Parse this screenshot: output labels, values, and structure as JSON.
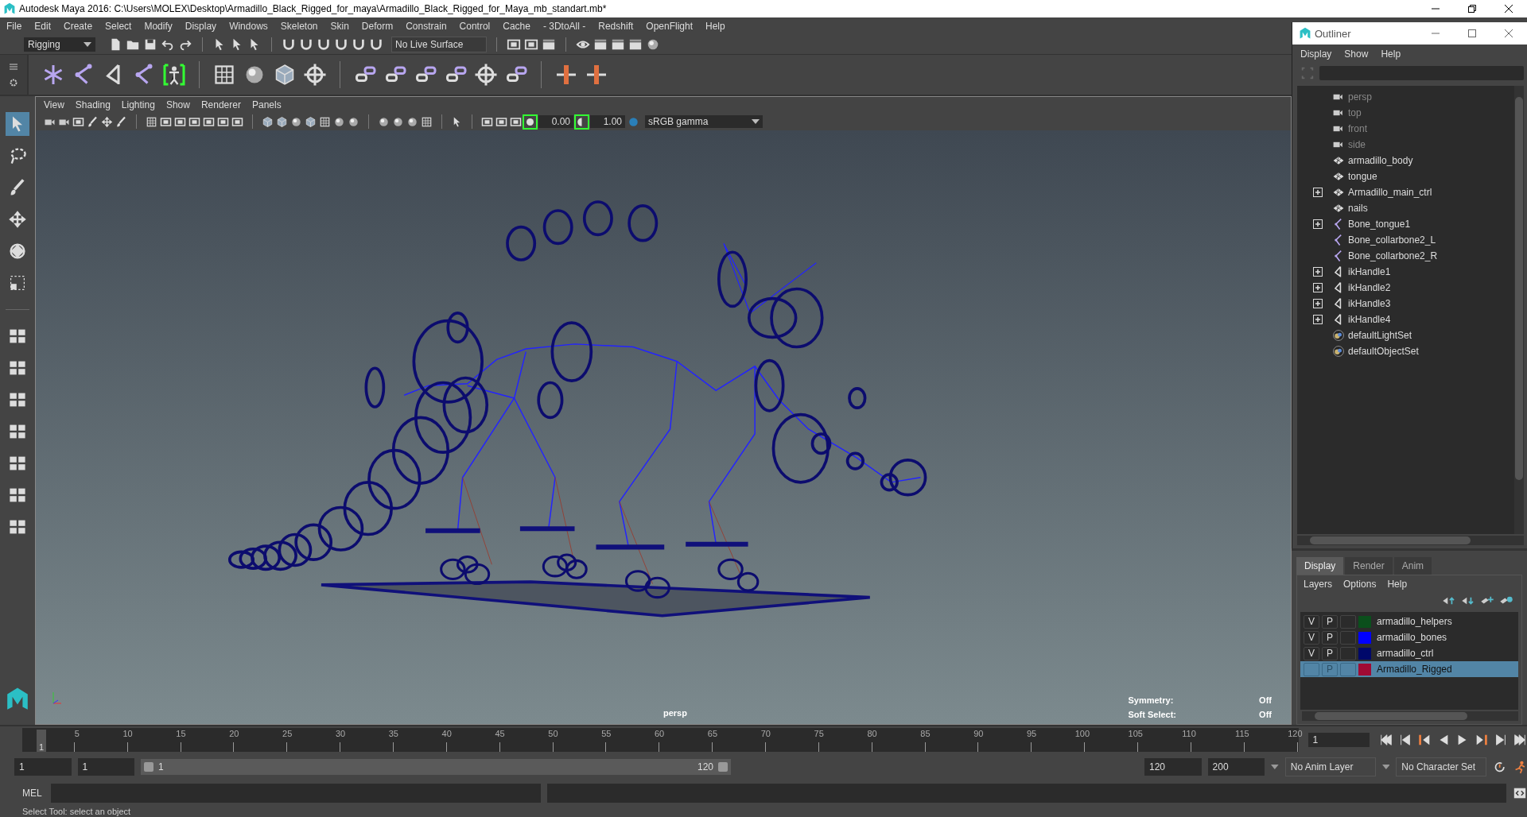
{
  "window": {
    "title": "Autodesk Maya 2016: C:\\Users\\MOLEX\\Desktop\\Armadillo_Black_Rigged_for_maya\\Armadillo_Black_Rigged_for_Maya_mb_standart.mb*"
  },
  "menu_bar": [
    "File",
    "Edit",
    "Create",
    "Select",
    "Modify",
    "Display",
    "Windows",
    "Skeleton",
    "Skin",
    "Deform",
    "Constrain",
    "Control",
    "Cache",
    "- 3DtoAll -",
    "Redshift",
    "OpenFlight",
    "Help"
  ],
  "status_line": {
    "menu_set": "Rigging",
    "live_surface": "No Live Surface"
  },
  "viewport": {
    "menus": [
      "View",
      "Shading",
      "Lighting",
      "Show",
      "Renderer",
      "Panels"
    ],
    "exposure": "0.00",
    "gamma": "1.00",
    "color_space": "sRGB gamma",
    "camera_label": "persp",
    "hud": [
      {
        "label": "Symmetry:",
        "value": "Off"
      },
      {
        "label": "Soft Select:",
        "value": "Off"
      }
    ]
  },
  "outliner": {
    "title": "Outliner",
    "menus": [
      "Display",
      "Show",
      "Help"
    ],
    "items": [
      {
        "name": "persp",
        "kind": "camera",
        "expandable": false,
        "dimmed": true
      },
      {
        "name": "top",
        "kind": "camera",
        "expandable": false,
        "dimmed": true
      },
      {
        "name": "front",
        "kind": "camera",
        "expandable": false,
        "dimmed": true
      },
      {
        "name": "side",
        "kind": "camera",
        "expandable": false,
        "dimmed": true
      },
      {
        "name": "armadillo_body",
        "kind": "mesh",
        "expandable": false,
        "dimmed": false
      },
      {
        "name": "tongue",
        "kind": "mesh",
        "expandable": false,
        "dimmed": false
      },
      {
        "name": "Armadillo_main_ctrl",
        "kind": "mesh",
        "expandable": true,
        "dimmed": false
      },
      {
        "name": "nails",
        "kind": "mesh",
        "expandable": false,
        "dimmed": false
      },
      {
        "name": "Bone_tongue1",
        "kind": "joint",
        "expandable": true,
        "dimmed": false
      },
      {
        "name": "Bone_collarbone2_L",
        "kind": "joint",
        "expandable": false,
        "dimmed": false
      },
      {
        "name": "Bone_collarbone2_R",
        "kind": "joint",
        "expandable": false,
        "dimmed": false
      },
      {
        "name": "ikHandle1",
        "kind": "ik",
        "expandable": true,
        "dimmed": false
      },
      {
        "name": "ikHandle2",
        "kind": "ik",
        "expandable": true,
        "dimmed": false
      },
      {
        "name": "ikHandle3",
        "kind": "ik",
        "expandable": true,
        "dimmed": false
      },
      {
        "name": "ikHandle4",
        "kind": "ik",
        "expandable": true,
        "dimmed": false
      },
      {
        "name": "defaultLightSet",
        "kind": "set",
        "expandable": false,
        "dimmed": false
      },
      {
        "name": "defaultObjectSet",
        "kind": "set",
        "expandable": false,
        "dimmed": false
      }
    ]
  },
  "layer_editor": {
    "tabs": [
      {
        "label": "Display",
        "selected": true
      },
      {
        "label": "Render",
        "selected": false
      },
      {
        "label": "Anim",
        "selected": false
      }
    ],
    "menus": [
      "Layers",
      "Options",
      "Help"
    ],
    "layers": [
      {
        "visibility": "V",
        "playback": "P",
        "name": "armadillo_helpers",
        "color": "#0b4f1c",
        "selected": false
      },
      {
        "visibility": "V",
        "playback": "P",
        "name": "armadillo_bones",
        "color": "#0000ff",
        "selected": false
      },
      {
        "visibility": "V",
        "playback": "P",
        "name": "armadillo_ctrl",
        "color": "#00086a",
        "selected": false
      },
      {
        "playback": "P",
        "name": "Armadillo_Rigged",
        "color": "#a00a34",
        "selected": true
      }
    ]
  },
  "timeline": {
    "current_frame": "1",
    "level": 0.01,
    "ticks": [
      "5",
      "10",
      "15",
      "20",
      "25",
      "30",
      "35",
      "40",
      "45",
      "50",
      "55",
      "60",
      "65",
      "70",
      "75",
      "80",
      "85",
      "90",
      "95",
      "100",
      "105",
      "110",
      "115",
      "120"
    ],
    "frame_field": "1"
  },
  "range": {
    "level": 1,
    "start": "1",
    "playback_start": "1",
    "slider_start": "1",
    "slider_end": "120",
    "playback_end": "120",
    "end": "200",
    "anim_layer": "No Anim Layer",
    "character_set": "No Character Set"
  },
  "command_line": {
    "label": "MEL"
  },
  "help_line": "Select Tool: select an object"
}
